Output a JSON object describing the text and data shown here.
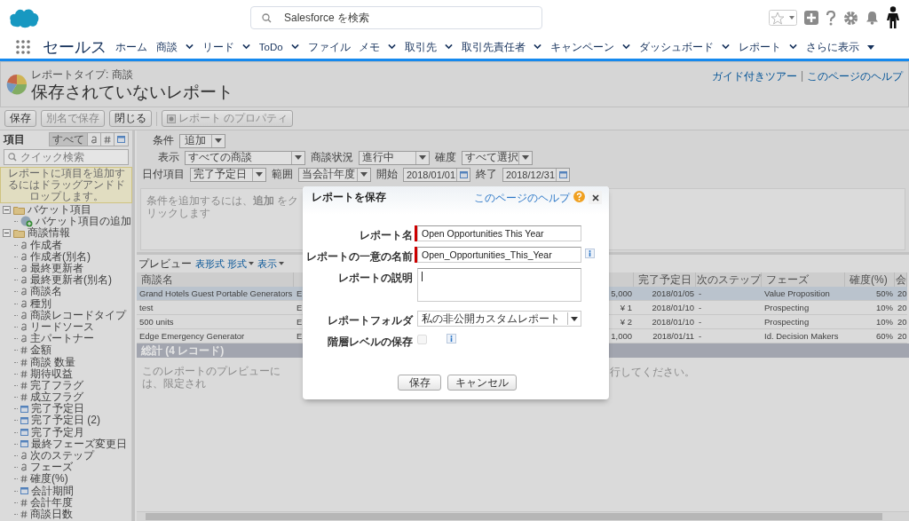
{
  "app": {
    "name": "セールス",
    "search_placeholder": "Salesforce を検索"
  },
  "nav": [
    {
      "label": "ホーム",
      "menu": false
    },
    {
      "label": "商談",
      "menu": true
    },
    {
      "label": "リード",
      "menu": true
    },
    {
      "label": "ToDo",
      "menu": true
    },
    {
      "label": "ファイル",
      "menu": false
    },
    {
      "label": "メモ",
      "menu": true
    },
    {
      "label": "取引先",
      "menu": true
    },
    {
      "label": "取引先責任者",
      "menu": true
    },
    {
      "label": "キャンペーン",
      "menu": true
    },
    {
      "label": "ダッシュボード",
      "menu": true
    },
    {
      "label": "レポート",
      "menu": true
    },
    {
      "label": "さらに表示",
      "menu": true,
      "kind": "more"
    }
  ],
  "report": {
    "type_label": "レポートタイプ: 商談",
    "title": "保存されていないレポート",
    "links": [
      "ガイド付きツアー",
      "このページのヘルプ"
    ],
    "link_separator": "|"
  },
  "toolbar": [
    {
      "label": "保存",
      "disabled": false,
      "kind": "plain"
    },
    {
      "label": "別名で保存",
      "disabled": true,
      "kind": "plain"
    },
    {
      "label": "閉じる",
      "disabled": false,
      "kind": "plain"
    },
    {
      "label": "レポート のプロパティ",
      "disabled": true,
      "kind": "properties"
    }
  ],
  "sidebar": {
    "title": "項目",
    "filters": [
      {
        "kind": "all",
        "label": "すべて",
        "selected": true
      },
      {
        "kind": "text",
        "selected": false
      },
      {
        "kind": "number",
        "selected": false
      },
      {
        "kind": "date",
        "selected": false
      }
    ],
    "search_placeholder": "クイック検索",
    "hint": "レポートに項目を追加するにはドラッグアンドドロップします。",
    "tree": [
      {
        "label": "バケット項目",
        "expanded": true,
        "children": [
          {
            "label": "バケット項目の追加",
            "kind": "add"
          }
        ]
      },
      {
        "label": "商談情報",
        "expanded": true,
        "children": [
          {
            "label": "作成者",
            "kind": "text"
          },
          {
            "label": "作成者(別名)",
            "kind": "text"
          },
          {
            "label": "最終更新者",
            "kind": "text"
          },
          {
            "label": "最終更新者(別名)",
            "kind": "text"
          },
          {
            "label": "商談名",
            "kind": "text"
          },
          {
            "label": "種別",
            "kind": "text"
          },
          {
            "label": "商談レコードタイプ",
            "kind": "text"
          },
          {
            "label": "リードソース",
            "kind": "text"
          },
          {
            "label": "主パートナー",
            "kind": "text"
          },
          {
            "label": "金額",
            "kind": "number"
          },
          {
            "label": "商談 数量",
            "kind": "number"
          },
          {
            "label": "期待収益",
            "kind": "number"
          },
          {
            "label": "完了フラグ",
            "kind": "number"
          },
          {
            "label": "成立フラグ",
            "kind": "number"
          },
          {
            "label": "完了予定日",
            "kind": "date"
          },
          {
            "label": "完了予定日 (2)",
            "kind": "date"
          },
          {
            "label": "完了予定月",
            "kind": "date"
          },
          {
            "label": "最終フェーズ変更日",
            "kind": "date"
          },
          {
            "label": "次のステップ",
            "kind": "text"
          },
          {
            "label": "フェーズ",
            "kind": "text"
          },
          {
            "label": "確度(%)",
            "kind": "number"
          },
          {
            "label": "会計期間",
            "kind": "date"
          },
          {
            "label": "会計年度",
            "kind": "number"
          },
          {
            "label": "商談日数",
            "kind": "number"
          }
        ]
      }
    ]
  },
  "filters": {
    "condition_label": "条件",
    "add_button": "追加",
    "rows": [
      [
        {
          "label": "表示",
          "value": "すべての商談",
          "kind": "select"
        },
        {
          "label": "商談状況",
          "value": "進行中",
          "kind": "select"
        },
        {
          "label": "確度",
          "value": "すべて選択",
          "kind": "select"
        }
      ],
      [
        {
          "label": "日付項目",
          "value": "完了予定日",
          "kind": "select"
        },
        {
          "label": "範囲",
          "value": "当会計年度",
          "kind": "select"
        },
        {
          "label": "開始",
          "value": "2018/01/01",
          "kind": "date"
        },
        {
          "label": "終了",
          "value": "2018/12/31",
          "kind": "date"
        }
      ]
    ],
    "hint": "条件を追加するには、**追加** をクリックします"
  },
  "preview": {
    "title": "プレビュー",
    "links": [
      {
        "label": "表形式 形式"
      },
      {
        "label": "表示"
      }
    ],
    "table": {
      "columns": [
        "商談名",
        "",
        "",
        "完了予定日",
        "次のステップ",
        "フェーズ",
        "確度(%)",
        "会"
      ],
      "rows": [
        {
          "selected": true,
          "cells": [
            "Grand Hotels Guest Portable Generators",
            "E",
            "5,000",
            "2018/01/05",
            "-",
            "Value Proposition",
            "50%",
            "20"
          ]
        },
        {
          "selected": false,
          "cells": [
            "test",
            "E",
            "¥ 1",
            "2018/01/10",
            "-",
            "Prospecting",
            "10%",
            "20"
          ]
        },
        {
          "selected": false,
          "cells": [
            "500 units",
            "E",
            "¥ 2",
            "2018/01/10",
            "-",
            "Prospecting",
            "10%",
            "20"
          ]
        },
        {
          "selected": false,
          "cells": [
            "Edge Emergency Generator",
            "E",
            "1,000",
            "2018/01/11",
            "-",
            "Id. Decision Makers",
            "60%",
            "20"
          ]
        }
      ],
      "total": "総計 (4 レコード)"
    },
    "message_start": "このレポートのプレビューには、限定され",
    "message_end": "行してください。"
  },
  "modal": {
    "title": "レポートを保存",
    "help": "このページのヘルプ",
    "fields": [
      {
        "kind": "text",
        "label": "レポート名",
        "value": "Open Opportunities This Year",
        "required": true
      },
      {
        "kind": "text",
        "label": "レポートの一意の名前",
        "value": "Open_Opportunities_This_Year",
        "required": true,
        "info": true
      },
      {
        "kind": "textarea",
        "label": "レポートの説明",
        "focused": true
      },
      {
        "kind": "select",
        "label": "レポートフォルダ",
        "value": "私の非公開カスタムレポート"
      },
      {
        "kind": "checkbox",
        "label": "階層レベルの保存",
        "checked": false,
        "disabled": true,
        "info": true
      }
    ],
    "buttons": [
      "保存",
      "キャンセル"
    ]
  }
}
